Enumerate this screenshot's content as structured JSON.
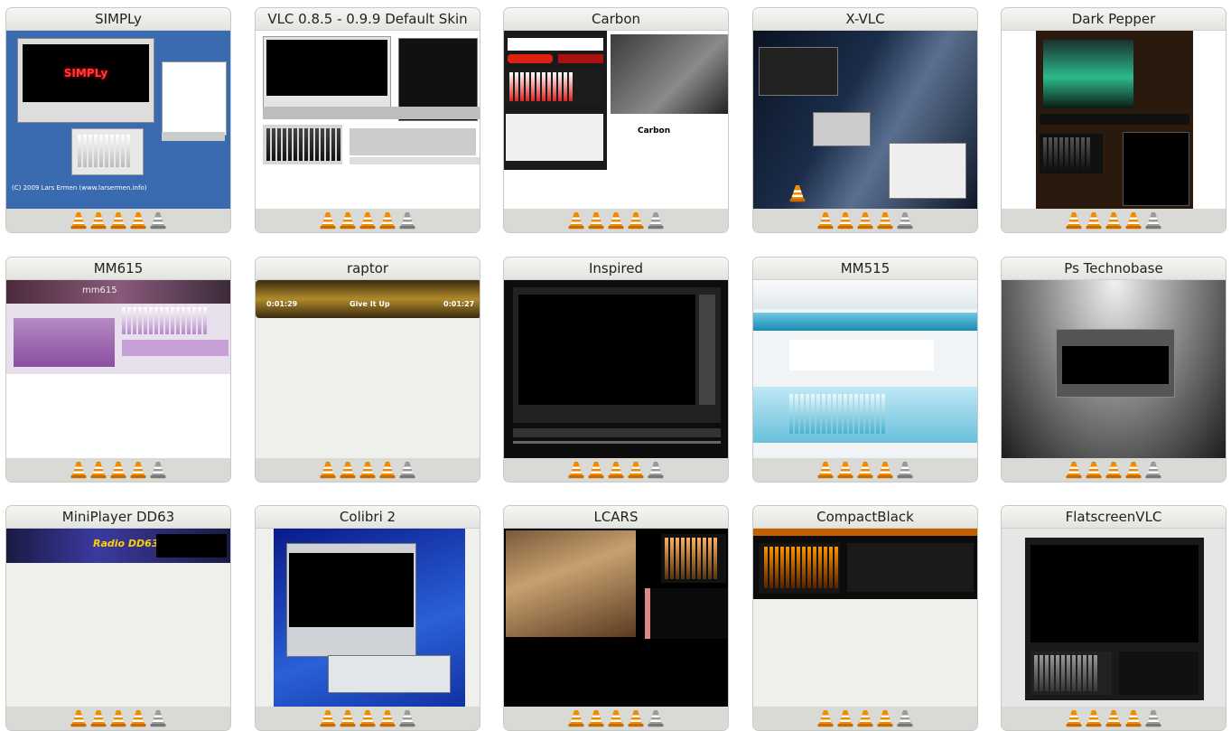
{
  "skins": [
    {
      "title": "SIMPLy",
      "rating": 4,
      "thumb": {
        "kind": "simply",
        "logo": "SIMPLy",
        "credit": "(C) 2009 Lars Ermen (www.larsermen.info)"
      }
    },
    {
      "title": "VLC 0.8.5 - 0.9.9 Default Skin",
      "rating": 4,
      "thumb": {
        "kind": "default"
      }
    },
    {
      "title": "Carbon",
      "rating": 4,
      "thumb": {
        "kind": "carbon",
        "logo": "Carbon"
      }
    },
    {
      "title": "X-VLC",
      "rating": 4,
      "thumb": {
        "kind": "xvlc"
      }
    },
    {
      "title": "Dark Pepper",
      "rating": 4,
      "thumb": {
        "kind": "darkpepper"
      }
    },
    {
      "title": "MM615",
      "rating": 4,
      "thumb": {
        "kind": "mm615",
        "logo": "mm615"
      }
    },
    {
      "title": "raptor",
      "rating": 4,
      "thumb": {
        "kind": "raptor",
        "time_left": "0:01:29",
        "track": "Give It Up",
        "time_right": "0:01:27"
      }
    },
    {
      "title": "Inspired",
      "rating": 4,
      "thumb": {
        "kind": "inspired"
      }
    },
    {
      "title": "MM515",
      "rating": 4,
      "thumb": {
        "kind": "mm515"
      }
    },
    {
      "title": "Ps Technobase",
      "rating": 4,
      "thumb": {
        "kind": "technobase"
      }
    },
    {
      "title": "MiniPlayer DD63",
      "rating": 4,
      "thumb": {
        "kind": "dd63",
        "logo": "Radio DD63"
      }
    },
    {
      "title": "Colibri 2",
      "rating": 4,
      "thumb": {
        "kind": "colibri"
      }
    },
    {
      "title": "LCARS",
      "rating": 4,
      "thumb": {
        "kind": "lcars"
      }
    },
    {
      "title": "CompactBlack",
      "rating": 4,
      "thumb": {
        "kind": "compactblack"
      }
    },
    {
      "title": "FlatscreenVLC",
      "rating": 4,
      "thumb": {
        "kind": "flatscreen"
      }
    }
  ],
  "colors": {
    "cone_orange": "#f08a00",
    "cone_gray": "#9a9a9a",
    "card_bg": "#efefeb",
    "title_bar": "#e6e6e2"
  }
}
